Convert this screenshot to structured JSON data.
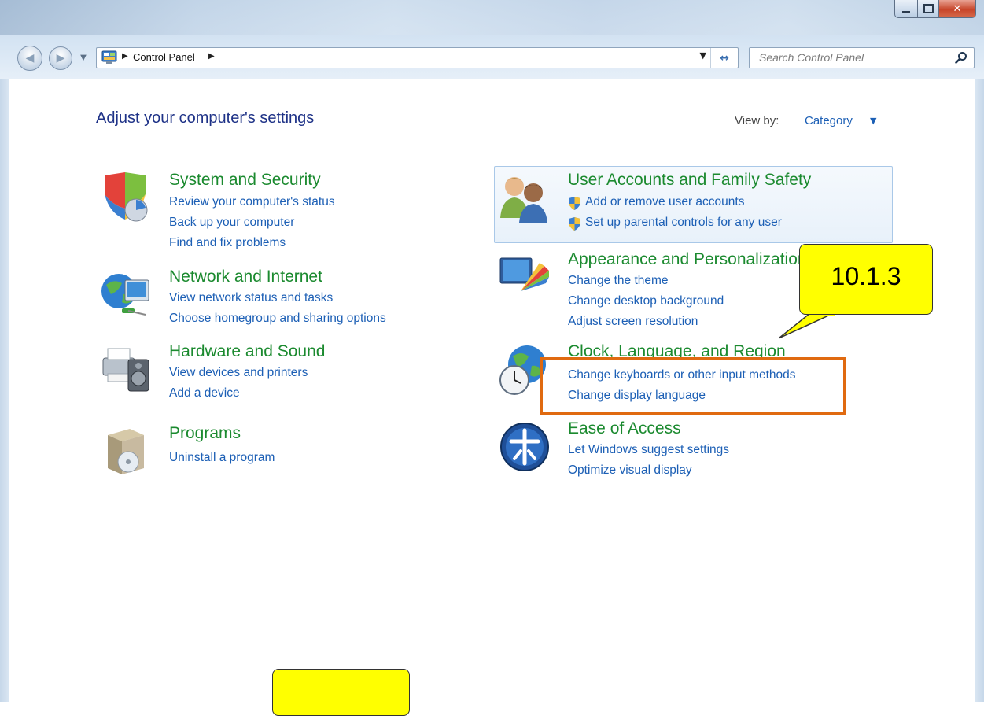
{
  "window": {
    "address": {
      "crumb": "Control Panel"
    },
    "search": {
      "placeholder": "Search Control Panel"
    }
  },
  "header": {
    "title": "Adjust your computer's settings",
    "view_by_label": "View by:",
    "view_by_value": "Category"
  },
  "categories_left": [
    {
      "name": "System and Security",
      "links": [
        "Review your computer's status",
        "Back up your computer",
        "Find and fix problems"
      ]
    },
    {
      "name": "Network and Internet",
      "links": [
        "View network status and tasks",
        "Choose homegroup and sharing options"
      ]
    },
    {
      "name": "Hardware and Sound",
      "links": [
        "View devices and printers",
        "Add a device"
      ]
    },
    {
      "name": "Programs",
      "links": [
        "Uninstall a program"
      ]
    }
  ],
  "categories_right": [
    {
      "name": "User Accounts and Family Safety",
      "links": [
        "Add or remove user accounts",
        "Set up parental controls for any user"
      ]
    },
    {
      "name": "Appearance and Personalization",
      "links": [
        "Change the theme",
        "Change desktop background",
        "Adjust screen resolution"
      ]
    },
    {
      "name": "Clock, Language, and Region",
      "links": [
        "Change keyboards or other input methods",
        "Change display language"
      ]
    },
    {
      "name": "Ease of Access",
      "links": [
        "Let Windows suggest settings",
        "Optimize visual display"
      ]
    }
  ],
  "annotation": {
    "label": "10.1.3"
  },
  "colors": {
    "heading_green": "#1b8a2f",
    "link_blue": "#1c5fb5",
    "title_blue": "#1e3287",
    "highlight_orange": "#e06a10",
    "callout_yellow": "#ffff00"
  }
}
